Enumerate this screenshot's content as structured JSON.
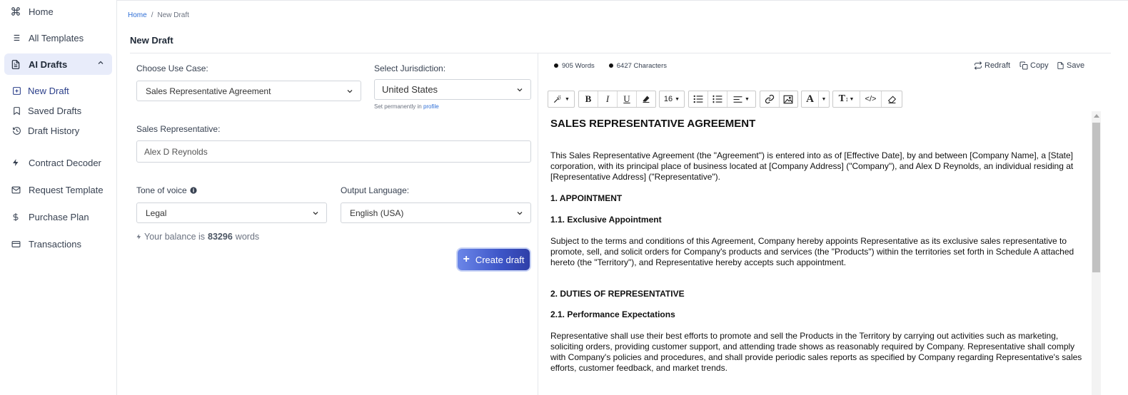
{
  "sidebar": {
    "home": "Home",
    "all_templates": "All Templates",
    "ai_drafts": "AI Drafts",
    "new_draft": "New Draft",
    "saved_drafts": "Saved Drafts",
    "draft_history": "Draft History",
    "contract_decoder": "Contract Decoder",
    "request_template": "Request Template",
    "purchase_plan": "Purchase Plan",
    "transactions": "Transactions"
  },
  "breadcrumb": {
    "home": "Home",
    "sep": "/",
    "current": "New Draft"
  },
  "page_title": "New Draft",
  "form": {
    "use_case_label": "Choose Use Case:",
    "use_case_value": "Sales Representative Agreement",
    "jurisdiction_label": "Select Jurisdiction:",
    "jurisdiction_value": "United States",
    "jurisdiction_hint": "Set permanently in",
    "jurisdiction_hint_link": "profile",
    "rep_label": "Sales Representative:",
    "rep_value": "Alex D Reynolds",
    "tone_label": "Tone of voice",
    "tone_value": "Legal",
    "language_label": "Output Language:",
    "language_value": "English (USA)",
    "balance_prefix": "Your balance is",
    "balance_value": "83296",
    "balance_suffix": "words",
    "create_button": "Create draft"
  },
  "editor": {
    "words": "905 Words",
    "characters": "6427 Characters",
    "redraft": "Redraft",
    "copy": "Copy",
    "save": "Save",
    "font_size": "16",
    "toolbar": {
      "bold": "B",
      "italic": "I",
      "underline": "U",
      "font_color": "A",
      "text_size": "T",
      "code": "</>"
    },
    "doc": {
      "title": "SALES REPRESENTATIVE AGREEMENT",
      "intro": "This Sales Representative Agreement (the \"Agreement\") is entered into as of [Effective Date], by and between [Company Name], a [State] corporation, with its principal place of business located at [Company Address] (\"Company\"), and Alex D Reynolds, an individual residing at [Representative Address] (\"Representative\").",
      "h1": "1. APPOINTMENT",
      "h1_1": "1.1. Exclusive Appointment",
      "p1_1": "Subject to the terms and conditions of this Agreement, Company hereby appoints Representative as its exclusive sales representative to promote, sell, and solicit orders for Company's products and services (the \"Products\") within the territories set forth in Schedule A attached hereto (the \"Territory\"), and Representative hereby accepts such appointment.",
      "h2": "2. DUTIES OF REPRESENTATIVE",
      "h2_1": "2.1. Performance Expectations",
      "p2_1": "Representative shall use their best efforts to promote and sell the Products in the Territory by carrying out activities such as marketing, soliciting orders, providing customer support, and attending trade shows as reasonably required by Company. Representative shall comply with Company's policies and procedures, and shall provide periodic sales reports as specified by Company regarding Representative's sales efforts, customer feedback, and market trends."
    }
  }
}
